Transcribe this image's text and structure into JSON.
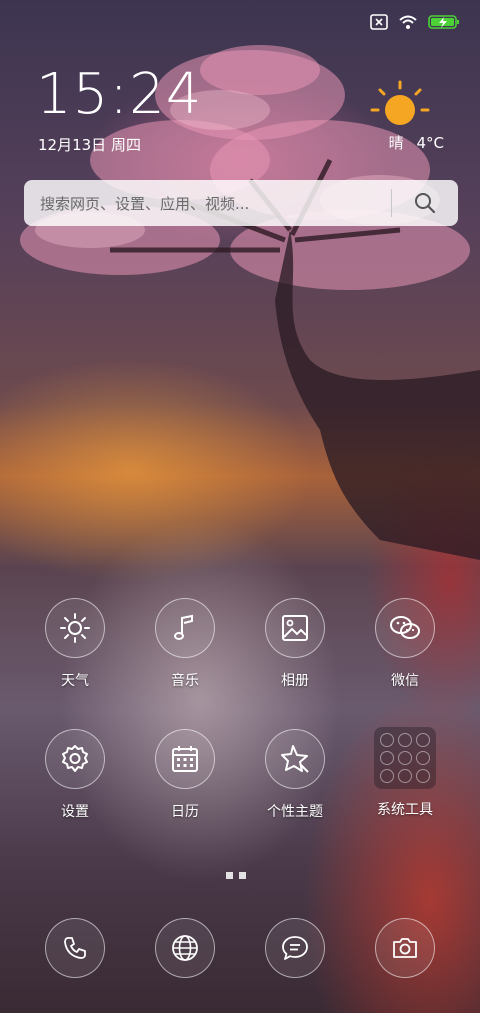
{
  "status_bar": {
    "icons": [
      "sim-none-icon",
      "wifi-icon",
      "battery-charging-icon"
    ],
    "accent": "#4cd137"
  },
  "lockscreen": {
    "time": "15:24",
    "date": "12月13日 周四",
    "weather": {
      "icon": "sun-icon",
      "condition": "晴",
      "temperature": "4°C",
      "sun_color": "#f5a623"
    }
  },
  "search": {
    "placeholder": "搜索网页、设置、应用、视频..."
  },
  "apps": [
    {
      "label": "天气",
      "icon": "sun-outline-icon"
    },
    {
      "label": "音乐",
      "icon": "music-note-icon"
    },
    {
      "label": "相册",
      "icon": "gallery-icon"
    },
    {
      "label": "微信",
      "icon": "wechat-icon"
    },
    {
      "label": "设置",
      "icon": "gear-icon"
    },
    {
      "label": "日历",
      "icon": "calendar-icon"
    },
    {
      "label": "个性主题",
      "icon": "theme-star-icon"
    },
    {
      "label": "系统工具",
      "icon": "folder-icon"
    }
  ],
  "page_indicator": {
    "pages": 2
  },
  "dock": [
    {
      "icon": "phone-icon"
    },
    {
      "icon": "globe-icon"
    },
    {
      "icon": "message-icon"
    },
    {
      "icon": "camera-icon"
    }
  ]
}
